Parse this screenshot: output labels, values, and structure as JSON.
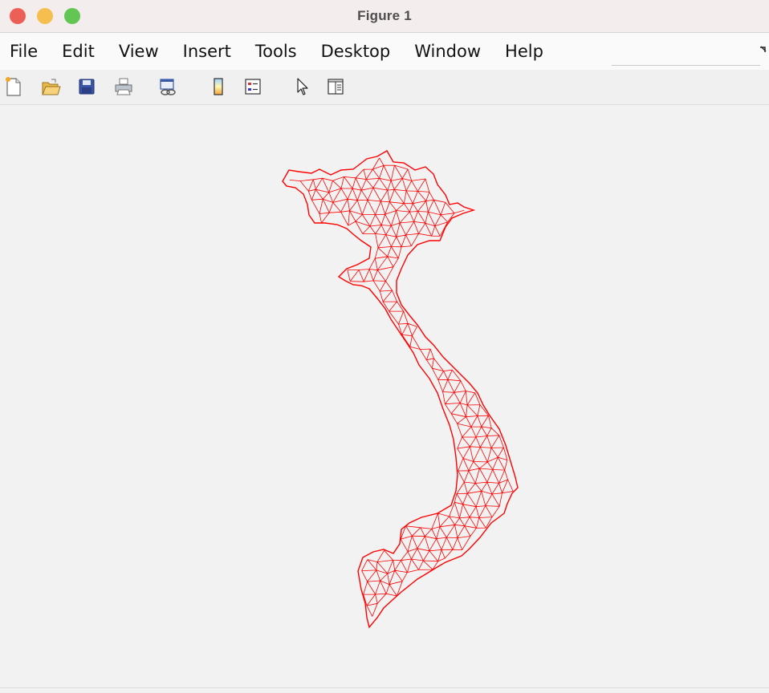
{
  "window": {
    "title": "Figure 1"
  },
  "menubar": {
    "items": [
      "File",
      "Edit",
      "View",
      "Insert",
      "Tools",
      "Desktop",
      "Window",
      "Help"
    ]
  },
  "toolbar": {
    "icons": [
      "new-figure-icon",
      "open-file-icon",
      "save-icon",
      "print-icon",
      "link-plot-icon",
      "insert-colorbar-icon",
      "insert-legend-icon",
      "edit-plot-arrow-icon",
      "property-inspector-icon"
    ]
  },
  "plot": {
    "mesh_color": "#ff0000",
    "background": "#f2f2f2"
  }
}
